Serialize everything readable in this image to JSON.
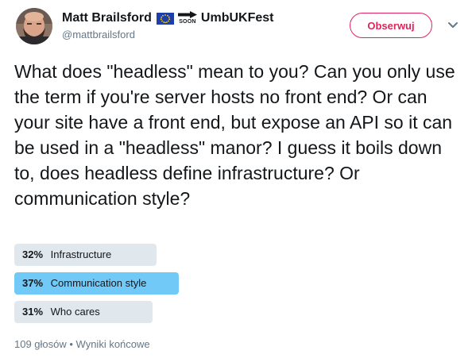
{
  "tweet": {
    "author": {
      "name": "Matt Brailsford",
      "soon_label": "SOON",
      "name_suffix": "UmbUKFest",
      "handle": "@mattbrailsford",
      "avatar_icon": "avatar-photo"
    },
    "follow_label": "Obserwuj",
    "menu_icon": "chevron-down-icon",
    "text": "What does \"headless\" mean to you? Can you only use the term if you're server hosts no front end? Or can your site have a front end, but expose an API so it can be used in a \"headless\" manor? I guess it boils down to, does headless define infrastructure? Or communication style?",
    "poll": {
      "options": [
        {
          "percent_label": "32%",
          "percent": 32,
          "label": "Infrastructure",
          "winner": false
        },
        {
          "percent_label": "37%",
          "percent": 37,
          "label": "Communication style",
          "winner": true
        },
        {
          "percent_label": "31%",
          "percent": 31,
          "label": "Who cares",
          "winner": false
        }
      ],
      "footer": "109 głosów • Wyniki końcowe"
    },
    "colors": {
      "accent": "#e0245e",
      "winner_bar": "#71c9f8",
      "bar": "#e1e8ed",
      "muted_text": "#657786",
      "text": "#14171a"
    }
  }
}
